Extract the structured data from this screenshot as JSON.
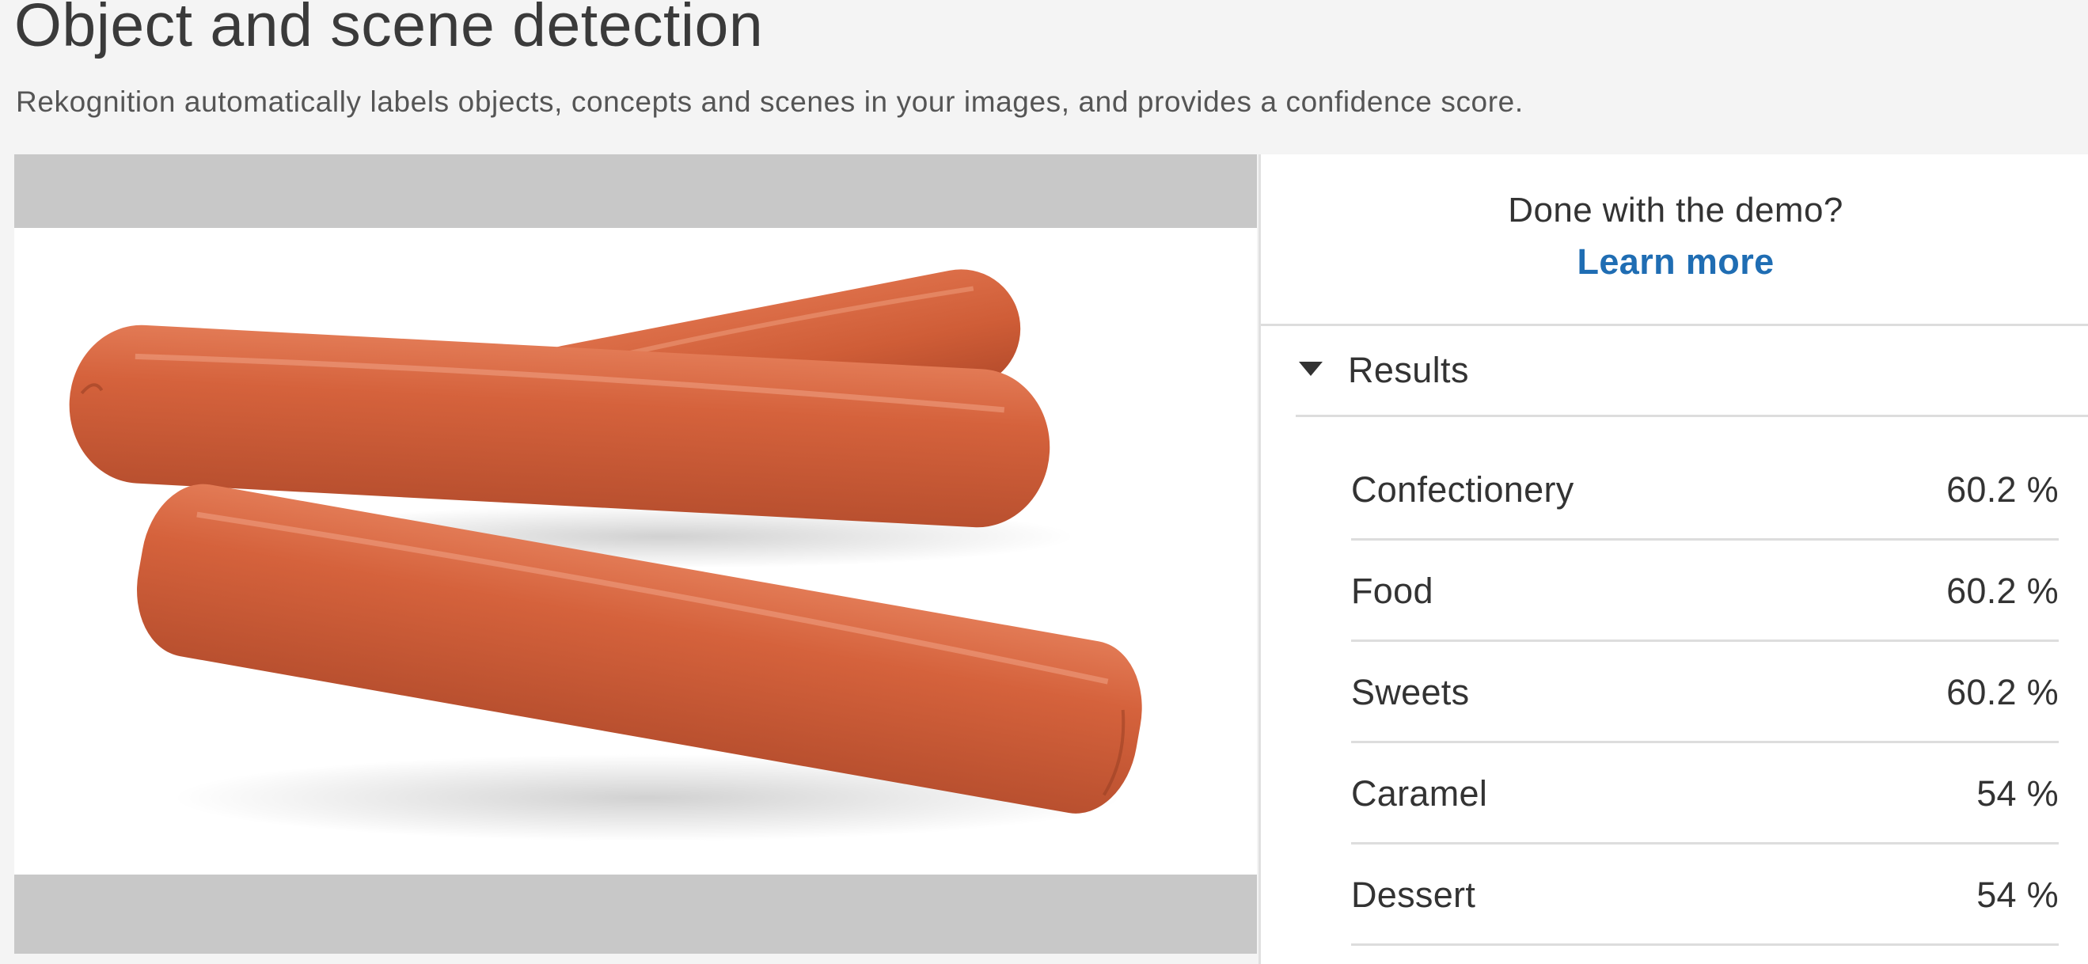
{
  "header": {
    "title": "Object and scene detection",
    "subtitle": "Rekognition automatically labels objects, concepts and scenes in your images, and provides a confidence score."
  },
  "cta": {
    "question": "Done with the demo?",
    "link_label": "Learn more"
  },
  "results": {
    "header_label": "Results",
    "expanded": true,
    "items": [
      {
        "label": "Confectionery",
        "confidence": "60.2 %"
      },
      {
        "label": "Food",
        "confidence": "60.2 %"
      },
      {
        "label": "Sweets",
        "confidence": "60.2 %"
      },
      {
        "label": "Caramel",
        "confidence": "54 %"
      },
      {
        "label": "Dessert",
        "confidence": "54 %"
      }
    ]
  },
  "colors": {
    "link": "#1f6db3",
    "image_letterbox": "#c8c8c8",
    "sausage": "#d0603a"
  },
  "image": {
    "subject": "three sausages on white background"
  }
}
